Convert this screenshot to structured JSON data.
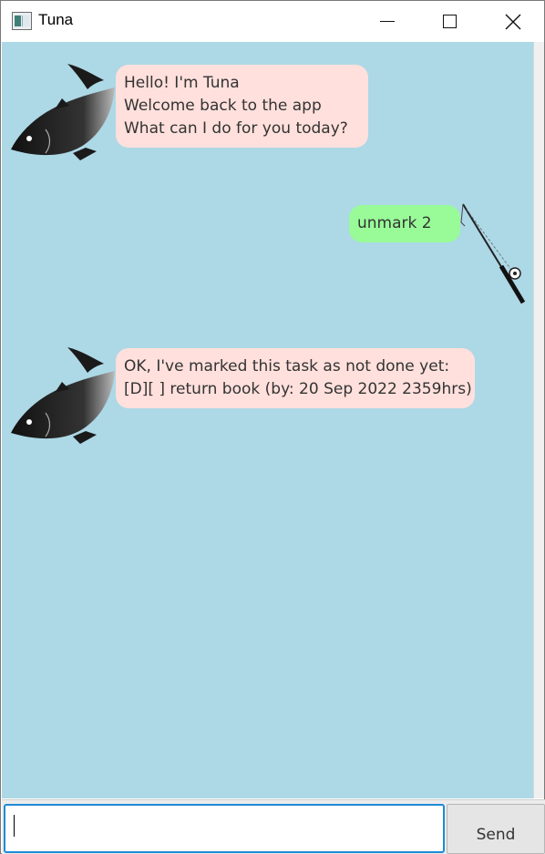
{
  "window": {
    "title": "Tuna"
  },
  "messages": [
    {
      "sender": "bot",
      "lines": [
        "Hello! I'm Tuna",
        "Welcome back to the app",
        "What can I do for you today?"
      ]
    },
    {
      "sender": "user",
      "lines": [
        "unmark 2"
      ]
    },
    {
      "sender": "bot",
      "lines": [
        "OK, I've marked this task as not done yet:",
        "[D][ ] return book (by: 20 Sep 2022 2359hrs)"
      ]
    }
  ],
  "input": {
    "value": "",
    "send_label": "Send"
  },
  "colors": {
    "chat_background": "#add8e6",
    "bot_bubble": "#ffe0dc",
    "user_bubble": "#98fb98"
  },
  "icons": {
    "bot_avatar": "fish-icon",
    "user_avatar": "fishing-rod-icon"
  }
}
